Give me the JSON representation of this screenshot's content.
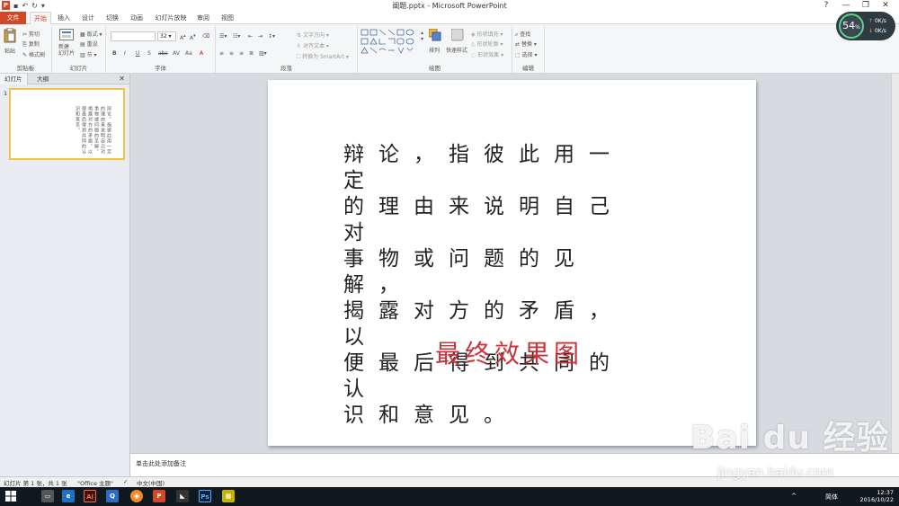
{
  "window": {
    "title": "阐题.pptx - Microsoft PowerPoint"
  },
  "tabs": [
    "文件",
    "开始",
    "插入",
    "设计",
    "切换",
    "动画",
    "幻灯片放映",
    "审阅",
    "视图"
  ],
  "ribbon": {
    "clipboard": {
      "label": "剪贴板",
      "paste": "粘贴",
      "cut": "剪切",
      "copy": "复制",
      "format_painter": "格式刷"
    },
    "slides": {
      "label": "幻灯片",
      "new_slide": "新建\n幻灯片",
      "layout": "版式",
      "reset": "重设",
      "section": "节"
    },
    "font": {
      "label": "字体",
      "size": "32"
    },
    "paragraph": {
      "label": "段落",
      "text_direction": "文字方向",
      "align_text": "对齐文本",
      "convert_smartart": "转换为 SmartArt"
    },
    "drawing": {
      "label": "绘图",
      "arrange": "排列",
      "quick_styles": "快速样式",
      "shape_fill": "形状填充",
      "shape_outline": "形状轮廓",
      "shape_effects": "形状效果"
    },
    "editing": {
      "label": "编辑",
      "find": "查找",
      "replace": "替换",
      "select": "选择"
    }
  },
  "pane": {
    "tabs": [
      "幻灯片",
      "大纲"
    ],
    "slide_number": "1",
    "thumb_text": "辩论，指彼此用一定的理由来说明自己对事物或问题的见解，揭露对方的矛盾，以便最后得到共同的认识和意见。"
  },
  "slide": {
    "lines": [
      "辩论，指彼此用一定",
      "的理由来说明自己对",
      "事物或问题的见解，",
      "揭露对方的矛盾，以",
      "便最后得到共同的认",
      "识和意见。"
    ],
    "caption": "最终效果图"
  },
  "notes": {
    "placeholder": "单击此处添加备注"
  },
  "status": {
    "slide_info": "幻灯片 第 1 张，共 1 张",
    "theme": "\"Office 主题\"",
    "language": "中文(中国)"
  },
  "taskbar": {
    "clock_time": "12:37",
    "clock_date": "2016/10/22",
    "ime": "简体"
  },
  "network_widget": {
    "percent": "54",
    "percent_unit": "%",
    "up": "0K/s",
    "down": "0K/s"
  },
  "watermark": {
    "brand": "Bai du 经验",
    "url": "jingyan.baidu.com"
  },
  "colors": {
    "accent": "#d24726",
    "caption_red": "#c8343b",
    "thumb_border": "#f0c24a"
  }
}
